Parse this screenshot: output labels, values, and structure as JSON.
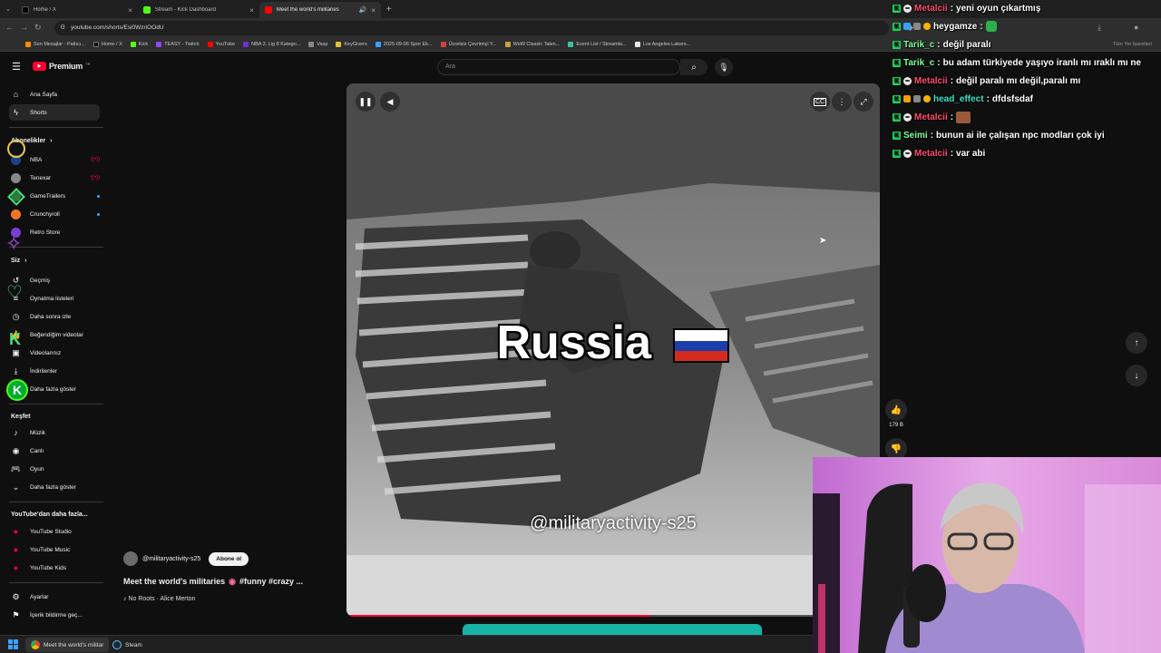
{
  "browser": {
    "tabs": [
      {
        "title": "Home / X",
        "icon": "x-logo-icon",
        "color": "#000000"
      },
      {
        "title": "Stream - Kick Dashboard",
        "icon": "kick-logo-icon",
        "color": "#53fc18"
      },
      {
        "title": "Meet the world's militaries",
        "icon": "youtube-logo-icon",
        "color": "#ff0000"
      }
    ],
    "new_tab": "+",
    "url": "youtube.com/shorts/Esi0WzriOOdU",
    "bookmarks": [
      "Son Mesajlar - Patlıcı...",
      "Home / X",
      "Kick",
      "TEASY - Twitch",
      "YouTube",
      "NBA 3. Lig 8 Katego...",
      "Vasp",
      "KeyGivers",
      "2025-09-06 Spor Ek...",
      "Ücretsiz Çevrimiçi Y...",
      "WoW Classic Talen...",
      "Event List / Streamla...",
      "Los Angeles Lakers..."
    ],
    "bookmarks_right": "Tüm Yer İşaretleri"
  },
  "youtube": {
    "logo_text": "Premium",
    "logo_sup": "TR",
    "search_placeholder": "Ara",
    "sidebar": {
      "top": [
        {
          "label": "Ana Sayfa",
          "icon": "home-icon"
        },
        {
          "label": "Shorts",
          "icon": "shorts-icon"
        }
      ],
      "subscriptions_header": "Abonelikler",
      "subscriptions": [
        {
          "label": "NBA",
          "color": "#1d428a"
        },
        {
          "label": "Tenexar",
          "color": "#888888"
        },
        {
          "label": "GameTrailers",
          "color": "#2b7a3d"
        },
        {
          "label": "Crunchyroll",
          "color": "#f47521"
        },
        {
          "label": "Retro Store",
          "color": "#7a3dd6"
        }
      ],
      "you_header": "Siz",
      "you": [
        {
          "label": "Geçmiş",
          "icon": "history-icon"
        },
        {
          "label": "Oynatma listeleri",
          "icon": "playlist-icon"
        },
        {
          "label": "Daha sonra izle",
          "icon": "clock-icon"
        },
        {
          "label": "Beğendiğim videolar",
          "icon": "thumbs-up-icon"
        },
        {
          "label": "Videolarınız",
          "icon": "video-icon"
        },
        {
          "label": "İndirilenler",
          "icon": "download-icon"
        },
        {
          "label": "Daha fazla göster",
          "icon": "chevron-down-icon"
        }
      ],
      "explore_header": "Keşfet",
      "explore": [
        {
          "label": "Müzik",
          "icon": "music-icon"
        },
        {
          "label": "Canlı",
          "icon": "live-icon"
        },
        {
          "label": "Oyun",
          "icon": "gaming-icon"
        },
        {
          "label": "Daha fazla göster",
          "icon": "chevron-down-icon"
        }
      ],
      "more_header": "YouTube'dan daha fazla...",
      "more": [
        {
          "label": "YouTube Studio"
        },
        {
          "label": "YouTube Music"
        },
        {
          "label": "YouTube Kids"
        }
      ],
      "bottom": [
        {
          "label": "Ayarlar",
          "icon": "gear-icon"
        },
        {
          "label": "İçerik bildirme geç...",
          "icon": "flag-icon"
        }
      ]
    },
    "short": {
      "caption": "Russia",
      "watermark": "@militaryactivity-s25",
      "channel": "@militaryactivity-s25",
      "subscribe_label": "Abone ol",
      "title": "Meet the world's militaries",
      "tags": "#funny #crazy ...",
      "music": "♪ No Roots · Alice Merton",
      "like_count": "179 B",
      "progress": 0.57
    }
  },
  "chat": {
    "messages": [
      {
        "user": "Metalcii",
        "text": "yeni oyun çıkartmış",
        "color": "#ff4d6d"
      },
      {
        "user": "heygamze",
        "text": "",
        "color": "#ffffff"
      },
      {
        "user": "Tarik_c",
        "text": "değil paralı",
        "color": "#7dff9a"
      },
      {
        "user": "Tarik_c",
        "text": "bu adam türkiyede yaşıyo iranlı mı ıraklı mı ne",
        "color": "#7dff9a"
      },
      {
        "user": "Metalcii",
        "text": "değil paralı mı değil,paralı mı",
        "color": "#ff4d6d"
      },
      {
        "user": "head_effect",
        "text": "dfdsfsdaf",
        "color": "#37e6c9"
      },
      {
        "user": "Metalcii",
        "text": "",
        "color": "#ff4d6d"
      },
      {
        "user": "Seimi",
        "text": "bunun ai ile çalışan npc modları çok iyi",
        "color": "#7dff9a"
      },
      {
        "user": "Metalcii",
        "text": "var abi",
        "color": "#ff4d6d"
      }
    ]
  },
  "taskbar": {
    "apps": [
      "Meet the world's militar",
      "Steam"
    ]
  }
}
